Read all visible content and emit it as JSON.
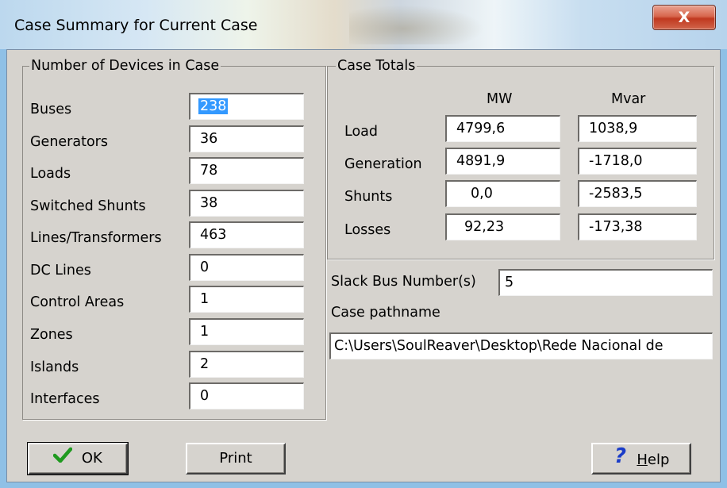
{
  "window": {
    "title": "Case Summary for Current Case",
    "close_label": "X"
  },
  "devices": {
    "legend": "Number of Devices in Case",
    "rows": [
      {
        "label": "Buses",
        "value": "238"
      },
      {
        "label": "Generators",
        "value": "36"
      },
      {
        "label": "Loads",
        "value": "78"
      },
      {
        "label": "Switched Shunts",
        "value": "38"
      },
      {
        "label": "Lines/Transformers",
        "value": "463"
      },
      {
        "label": "DC Lines",
        "value": "0"
      },
      {
        "label": "Control Areas",
        "value": "1"
      },
      {
        "label": "Zones",
        "value": "1"
      },
      {
        "label": "Islands",
        "value": "2"
      },
      {
        "label": "Interfaces",
        "value": "0"
      }
    ]
  },
  "totals": {
    "legend": "Case Totals",
    "col_mw": "MW",
    "col_mvar": "Mvar",
    "rows": [
      {
        "label": "Load",
        "mw": "4799,6",
        "mvar": "1038,9"
      },
      {
        "label": "Generation",
        "mw": "4891,9",
        "mvar": "-1718,0"
      },
      {
        "label": "Shunts",
        "mw": "0,0",
        "mvar": "-2583,5"
      },
      {
        "label": "Losses",
        "mw": "92,23",
        "mvar": "-173,38"
      }
    ]
  },
  "slack": {
    "label": "Slack Bus Number(s)",
    "value": "5"
  },
  "pathname": {
    "label": "Case pathname",
    "value": "C:\\Users\\SoulReaver\\Desktop\\Rede Nacional de"
  },
  "buttons": {
    "ok": "OK",
    "print": "Print",
    "help_underlined": "H",
    "help_rest": "elp"
  },
  "colors": {
    "selection": "#3399ff",
    "ok_check": "#1f9a1f",
    "help_icon": "#1a3cc8",
    "close_button": "#c9452c"
  },
  "icons": {
    "ok": "check-icon",
    "help": "question-mark-icon",
    "close": "close-icon"
  }
}
